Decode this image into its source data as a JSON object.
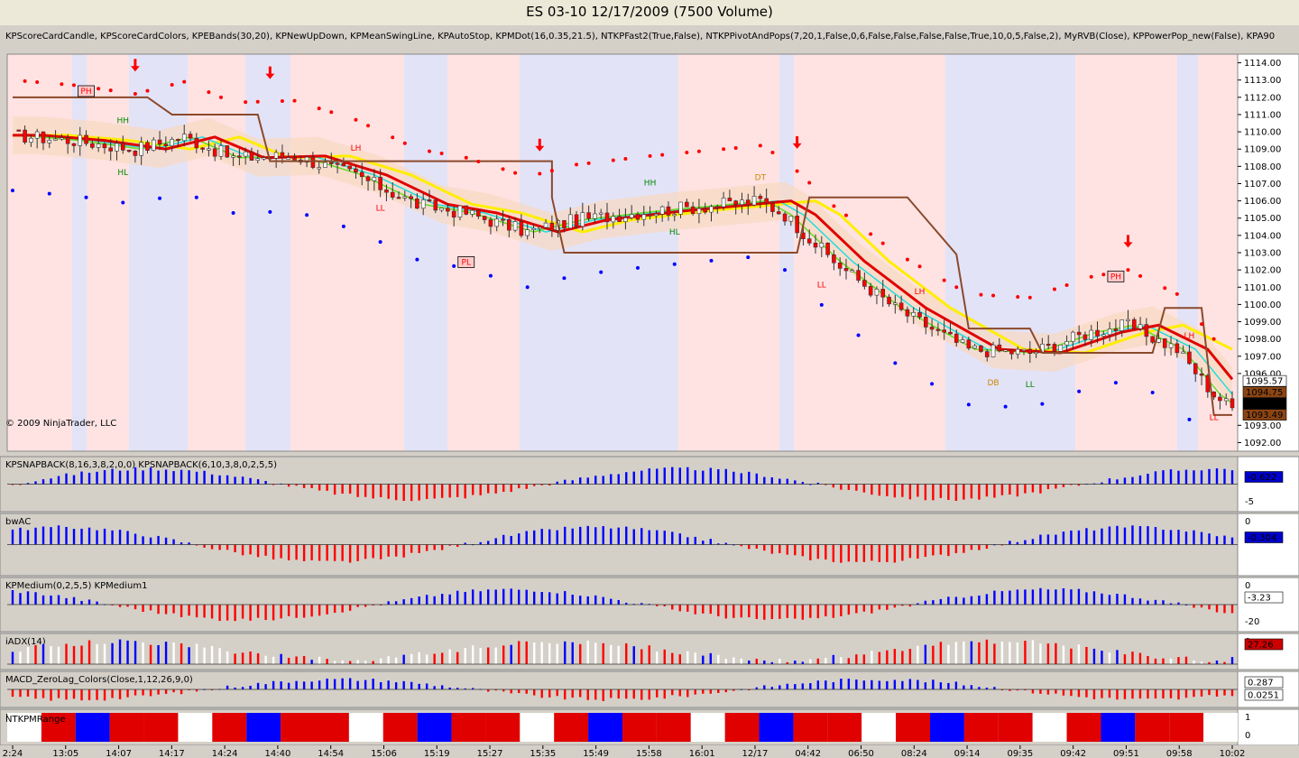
{
  "window": {
    "title": "ES 03-10  12/17/2009 (7500 Volume)"
  },
  "main_panel": {
    "indicator_line": "KPScoreCardCandle,  KPScoreCardColors,  KPEBands(30,20),  KPNewUpDown,  KPMeanSwingLine,  KPAutoStop,  KPMDot(16,0.35,21.5),  NTKPFast2(True,False),  NTKPPivotAndPops(7,20,1,False,0,6,False,False,False,False,True,10,0,5,False,2),  MyRVB(Close),  KPPowerPop_new(False),  KPA90",
    "copyright": "© 2009 NinjaTrader, LLC",
    "price_ticks": [
      "1114.00",
      "1113.00",
      "1112.00",
      "1111.00",
      "1110.00",
      "1109.00",
      "1108.00",
      "1107.00",
      "1106.00",
      "1105.00",
      "1104.00",
      "1103.00",
      "1102.00",
      "1101.00",
      "1100.00",
      "1099.00",
      "1098.00",
      "1097.00",
      "1096.00",
      "1093.00",
      "1092.00"
    ],
    "price_boxes": [
      {
        "text": "1095.57",
        "bg": "#ffffff",
        "fg": "#000000"
      },
      {
        "text": "1094.75",
        "bg": "#8b4513",
        "fg": "#ffffff"
      },
      {
        "text": "1094.00",
        "bg": "#000000",
        "fg": "#ffffff"
      },
      {
        "text": "1093.49",
        "bg": "#8b4513",
        "fg": "#ffffff"
      }
    ],
    "annotations": {
      "ph": "PH",
      "pl": "PL",
      "hh": "HH",
      "hl": "HL",
      "lh": "LH",
      "ll": "LL",
      "dt": "DT",
      "db": "DB"
    }
  },
  "panels": [
    {
      "label": "KPSNAPBACK(8,16,3,8,2,0,0)  KPSNAPBACK(6,10,3,8,0,2,5,5)",
      "ticks": [
        "",
        "-5"
      ],
      "value": "-0.622",
      "value_bg": "#0000cc"
    },
    {
      "label": "bwAC",
      "ticks": [
        "0"
      ],
      "value": "-0.304",
      "value_bg": "#0000cc"
    },
    {
      "label": "KPMedium(0,2,5,5)  KPMedium1",
      "ticks": [
        "0",
        "-20"
      ],
      "value": "-3.23",
      "value_bg": "#ffffff"
    },
    {
      "label": "iADX(14)",
      "ticks": [
        "0"
      ],
      "value": "27.26",
      "value_bg": "#cc0000"
    },
    {
      "label": "MACD_ZeroLag_Colors(Close,1,12,26,9,0)",
      "ticks": [],
      "value": "0.287",
      "value2": "0.0251",
      "value_bg": "#ffffff"
    },
    {
      "label": "NTKPMRange",
      "ticks": [
        "1",
        "0"
      ],
      "value": "",
      "value_bg": "#ffffff"
    }
  ],
  "time_labels": [
    "2:24",
    "13:05",
    "14:07",
    "14:17",
    "14:24",
    "14:40",
    "14:54",
    "15:06",
    "15:19",
    "15:27",
    "15:35",
    "15:49",
    "15:58",
    "16:01",
    "12/17",
    "04:42",
    "06:50",
    "08:24",
    "09:14",
    "09:35",
    "09:42",
    "09:51",
    "09:58",
    "10:02"
  ],
  "colors": {
    "up": "#0000ff",
    "down": "#ff0000",
    "bg_red": "#ffe3e3",
    "bg_blue": "#e3e3f8",
    "ema_red": "#e00000",
    "ema_yellow": "#ffee00",
    "ema_cyan": "#22dddd",
    "ema_green": "#66dd22",
    "stop": "#8b4a2b",
    "band": "#f8d8c0"
  },
  "chart_data": [
    {
      "type": "line",
      "title": "ES 03-10  12/17/2009 (7500 Volume)",
      "x": [
        "2:24",
        "13:05",
        "14:07",
        "14:17",
        "14:24",
        "14:40",
        "14:54",
        "15:06",
        "15:19",
        "15:27",
        "15:35",
        "15:49",
        "15:58",
        "16:01",
        "12/17",
        "04:42",
        "06:50",
        "08:24",
        "09:14",
        "09:35",
        "09:42",
        "09:51",
        "09:58",
        "10:02"
      ],
      "series": [
        {
          "values": [
            1109.8,
            1109.5,
            1109.0,
            1109.6,
            1108.7,
            1108.4,
            1107.4,
            1105.8,
            1105.4,
            1104.2,
            1104.8,
            1105.3,
            1105.6,
            1105.9,
            1104.5,
            1102.0,
            1099.6,
            1097.2,
            1096.9,
            1098.6,
            1098.8,
            1097.6,
            1094.9,
            1094.0
          ]
        }
      ],
      "ylim": [
        1091.5,
        1114.5
      ]
    },
    {
      "type": "bar",
      "title": "NTKPMRange",
      "categories": [
        "2:24",
        "13:05",
        "14:07",
        "14:17",
        "14:24",
        "14:40",
        "14:54",
        "15:06",
        "15:19",
        "15:27",
        "15:35",
        "15:49",
        "15:58",
        "16:01",
        "12/17",
        "04:42",
        "06:50",
        "08:24",
        "09:14",
        "09:35",
        "09:42",
        "09:51",
        "09:58",
        "10:02"
      ],
      "values": [
        1,
        1,
        1,
        1,
        1,
        1,
        1,
        1,
        1,
        1,
        1,
        1,
        1,
        1,
        1,
        1,
        1,
        1,
        1,
        1,
        1,
        1,
        1,
        1
      ],
      "ylim": [
        0,
        1
      ]
    }
  ]
}
